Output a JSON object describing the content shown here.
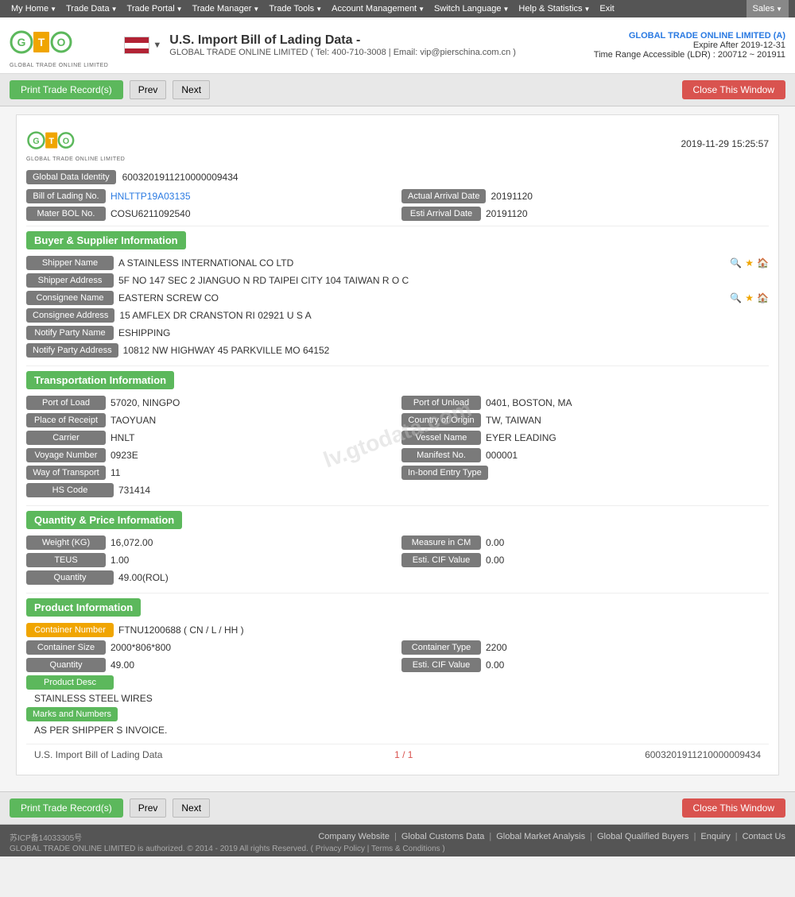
{
  "nav": {
    "items": [
      {
        "label": "My Home",
        "arrow": true
      },
      {
        "label": "Trade Data",
        "arrow": true
      },
      {
        "label": "Trade Portal",
        "arrow": true
      },
      {
        "label": "Trade Manager",
        "arrow": true
      },
      {
        "label": "Trade Tools",
        "arrow": true
      },
      {
        "label": "Account Management",
        "arrow": true
      },
      {
        "label": "Switch Language",
        "arrow": true
      },
      {
        "label": "Help & Statistics",
        "arrow": true
      },
      {
        "label": "Exit",
        "arrow": false
      }
    ],
    "sales_label": "Sales"
  },
  "header": {
    "title": "U.S. Import Bill of Lading Data  -",
    "subtitle": "GLOBAL TRADE ONLINE LIMITED ( Tel: 400-710-3008 | Email: vip@pierschina.com.cn )",
    "company": "GLOBAL TRADE ONLINE LIMITED (A)",
    "expire": "Expire After 2019-12-31",
    "ldr": "Time Range Accessible (LDR) : 200712 ~ 201911"
  },
  "toolbar": {
    "print_label": "Print Trade Record(s)",
    "prev_label": "Prev",
    "next_label": "Next",
    "close_label": "Close This Window"
  },
  "record": {
    "datetime": "2019-11-29 15:25:57",
    "global_data_identity_label": "Global Data Identity",
    "global_data_identity_value": "6003201911210000009434",
    "bill_of_lading_label": "Bill of Lading No.",
    "bill_of_lading_value": "HNLTTP19A03135",
    "actual_arrival_date_label": "Actual Arrival Date",
    "actual_arrival_date_value": "20191120",
    "mater_bol_label": "Mater BOL No.",
    "mater_bol_value": "COSU6211092540",
    "esti_arrival_date_label": "Esti Arrival Date",
    "esti_arrival_date_value": "20191120"
  },
  "buyer_supplier": {
    "section_label": "Buyer & Supplier Information",
    "shipper_name_label": "Shipper Name",
    "shipper_name_value": "A STAINLESS INTERNATIONAL CO LTD",
    "shipper_address_label": "Shipper Address",
    "shipper_address_value": "5F NO 147 SEC 2 JIANGUO N RD TAIPEI CITY 104 TAIWAN R O C",
    "consignee_name_label": "Consignee Name",
    "consignee_name_value": "EASTERN SCREW CO",
    "consignee_address_label": "Consignee Address",
    "consignee_address_value": "15 AMFLEX DR CRANSTON RI 02921 U S A",
    "notify_party_name_label": "Notify Party Name",
    "notify_party_name_value": "ESHIPPING",
    "notify_party_address_label": "Notify Party Address",
    "notify_party_address_value": "10812 NW HIGHWAY 45 PARKVILLE MO 64152"
  },
  "transportation": {
    "section_label": "Transportation Information",
    "port_of_load_label": "Port of Load",
    "port_of_load_value": "57020, NINGPO",
    "port_of_unload_label": "Port of Unload",
    "port_of_unload_value": "0401, BOSTON, MA",
    "place_of_receipt_label": "Place of Receipt",
    "place_of_receipt_value": "TAOYUAN",
    "country_of_origin_label": "Country of Origin",
    "country_of_origin_value": "TW, TAIWAN",
    "carrier_label": "Carrier",
    "carrier_value": "HNLT",
    "vessel_name_label": "Vessel Name",
    "vessel_name_value": "EYER LEADING",
    "voyage_number_label": "Voyage Number",
    "voyage_number_value": "0923E",
    "manifest_no_label": "Manifest No.",
    "manifest_no_value": "000001",
    "way_of_transport_label": "Way of Transport",
    "way_of_transport_value": "11",
    "in_bond_entry_label": "In-bond Entry Type",
    "in_bond_entry_value": "",
    "hs_code_label": "HS Code",
    "hs_code_value": "731414"
  },
  "quantity_price": {
    "section_label": "Quantity & Price Information",
    "weight_label": "Weight (KG)",
    "weight_value": "16,072.00",
    "measure_in_cm_label": "Measure in CM",
    "measure_in_cm_value": "0.00",
    "teus_label": "TEUS",
    "teus_value": "1.00",
    "esti_cif_value_label": "Esti. CIF Value",
    "esti_cif_value_value": "0.00",
    "quantity_label": "Quantity",
    "quantity_value": "49.00(ROL)"
  },
  "product": {
    "section_label": "Product Information",
    "container_number_label": "Container Number",
    "container_number_value": "FTNU1200688 ( CN / L / HH )",
    "container_size_label": "Container Size",
    "container_size_value": "2000*806*800",
    "container_type_label": "Container Type",
    "container_type_value": "2200",
    "quantity_label": "Quantity",
    "quantity_value": "49.00",
    "esti_cif_label": "Esti. CIF Value",
    "esti_cif_value": "0.00",
    "product_desc_label": "Product Desc",
    "product_desc_value": "STAINLESS STEEL WIRES",
    "marks_label": "Marks and Numbers",
    "marks_value": "AS PER SHIPPER S INVOICE."
  },
  "pagination": {
    "left_label": "U.S. Import Bill of Lading Data",
    "center_label": "1 / 1",
    "right_label": "6003201911210000009434"
  },
  "footer_links": [
    "Company Website",
    "Global Customs Data",
    "Global Market Analysis",
    "Global Qualified Buyers",
    "Enquiry",
    "Contact Us"
  ],
  "footer_copy": "GLOBAL TRADE ONLINE LIMITED is authorized. © 2014 - 2019 All rights Reserved.  (  Privacy Policy  |  Terms & Conditions  )",
  "footer_icp": "苏ICP备14033305号",
  "watermark": "lv.gtodata.com"
}
